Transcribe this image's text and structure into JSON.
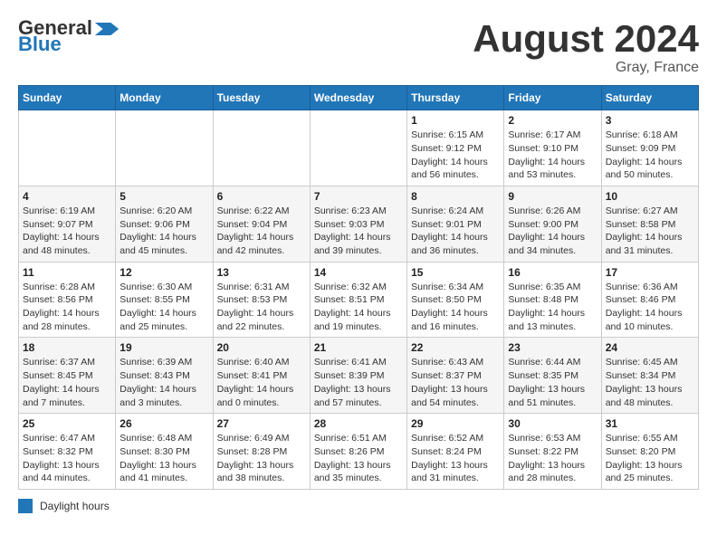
{
  "header": {
    "logo_general": "General",
    "logo_blue": "Blue",
    "month_year": "August 2024",
    "location": "Gray, France"
  },
  "days_of_week": [
    "Sunday",
    "Monday",
    "Tuesday",
    "Wednesday",
    "Thursday",
    "Friday",
    "Saturday"
  ],
  "legend": {
    "label": "Daylight hours"
  },
  "weeks": [
    {
      "days": [
        {
          "number": "",
          "info": ""
        },
        {
          "number": "",
          "info": ""
        },
        {
          "number": "",
          "info": ""
        },
        {
          "number": "",
          "info": ""
        },
        {
          "number": "1",
          "info": "Sunrise: 6:15 AM\nSunset: 9:12 PM\nDaylight: 14 hours\nand 56 minutes."
        },
        {
          "number": "2",
          "info": "Sunrise: 6:17 AM\nSunset: 9:10 PM\nDaylight: 14 hours\nand 53 minutes."
        },
        {
          "number": "3",
          "info": "Sunrise: 6:18 AM\nSunset: 9:09 PM\nDaylight: 14 hours\nand 50 minutes."
        }
      ]
    },
    {
      "days": [
        {
          "number": "4",
          "info": "Sunrise: 6:19 AM\nSunset: 9:07 PM\nDaylight: 14 hours\nand 48 minutes."
        },
        {
          "number": "5",
          "info": "Sunrise: 6:20 AM\nSunset: 9:06 PM\nDaylight: 14 hours\nand 45 minutes."
        },
        {
          "number": "6",
          "info": "Sunrise: 6:22 AM\nSunset: 9:04 PM\nDaylight: 14 hours\nand 42 minutes."
        },
        {
          "number": "7",
          "info": "Sunrise: 6:23 AM\nSunset: 9:03 PM\nDaylight: 14 hours\nand 39 minutes."
        },
        {
          "number": "8",
          "info": "Sunrise: 6:24 AM\nSunset: 9:01 PM\nDaylight: 14 hours\nand 36 minutes."
        },
        {
          "number": "9",
          "info": "Sunrise: 6:26 AM\nSunset: 9:00 PM\nDaylight: 14 hours\nand 34 minutes."
        },
        {
          "number": "10",
          "info": "Sunrise: 6:27 AM\nSunset: 8:58 PM\nDaylight: 14 hours\nand 31 minutes."
        }
      ]
    },
    {
      "days": [
        {
          "number": "11",
          "info": "Sunrise: 6:28 AM\nSunset: 8:56 PM\nDaylight: 14 hours\nand 28 minutes."
        },
        {
          "number": "12",
          "info": "Sunrise: 6:30 AM\nSunset: 8:55 PM\nDaylight: 14 hours\nand 25 minutes."
        },
        {
          "number": "13",
          "info": "Sunrise: 6:31 AM\nSunset: 8:53 PM\nDaylight: 14 hours\nand 22 minutes."
        },
        {
          "number": "14",
          "info": "Sunrise: 6:32 AM\nSunset: 8:51 PM\nDaylight: 14 hours\nand 19 minutes."
        },
        {
          "number": "15",
          "info": "Sunrise: 6:34 AM\nSunset: 8:50 PM\nDaylight: 14 hours\nand 16 minutes."
        },
        {
          "number": "16",
          "info": "Sunrise: 6:35 AM\nSunset: 8:48 PM\nDaylight: 14 hours\nand 13 minutes."
        },
        {
          "number": "17",
          "info": "Sunrise: 6:36 AM\nSunset: 8:46 PM\nDaylight: 14 hours\nand 10 minutes."
        }
      ]
    },
    {
      "days": [
        {
          "number": "18",
          "info": "Sunrise: 6:37 AM\nSunset: 8:45 PM\nDaylight: 14 hours\nand 7 minutes."
        },
        {
          "number": "19",
          "info": "Sunrise: 6:39 AM\nSunset: 8:43 PM\nDaylight: 14 hours\nand 3 minutes."
        },
        {
          "number": "20",
          "info": "Sunrise: 6:40 AM\nSunset: 8:41 PM\nDaylight: 14 hours\nand 0 minutes."
        },
        {
          "number": "21",
          "info": "Sunrise: 6:41 AM\nSunset: 8:39 PM\nDaylight: 13 hours\nand 57 minutes."
        },
        {
          "number": "22",
          "info": "Sunrise: 6:43 AM\nSunset: 8:37 PM\nDaylight: 13 hours\nand 54 minutes."
        },
        {
          "number": "23",
          "info": "Sunrise: 6:44 AM\nSunset: 8:35 PM\nDaylight: 13 hours\nand 51 minutes."
        },
        {
          "number": "24",
          "info": "Sunrise: 6:45 AM\nSunset: 8:34 PM\nDaylight: 13 hours\nand 48 minutes."
        }
      ]
    },
    {
      "days": [
        {
          "number": "25",
          "info": "Sunrise: 6:47 AM\nSunset: 8:32 PM\nDaylight: 13 hours\nand 44 minutes."
        },
        {
          "number": "26",
          "info": "Sunrise: 6:48 AM\nSunset: 8:30 PM\nDaylight: 13 hours\nand 41 minutes."
        },
        {
          "number": "27",
          "info": "Sunrise: 6:49 AM\nSunset: 8:28 PM\nDaylight: 13 hours\nand 38 minutes."
        },
        {
          "number": "28",
          "info": "Sunrise: 6:51 AM\nSunset: 8:26 PM\nDaylight: 13 hours\nand 35 minutes."
        },
        {
          "number": "29",
          "info": "Sunrise: 6:52 AM\nSunset: 8:24 PM\nDaylight: 13 hours\nand 31 minutes."
        },
        {
          "number": "30",
          "info": "Sunrise: 6:53 AM\nSunset: 8:22 PM\nDaylight: 13 hours\nand 28 minutes."
        },
        {
          "number": "31",
          "info": "Sunrise: 6:55 AM\nSunset: 8:20 PM\nDaylight: 13 hours\nand 25 minutes."
        }
      ]
    }
  ]
}
